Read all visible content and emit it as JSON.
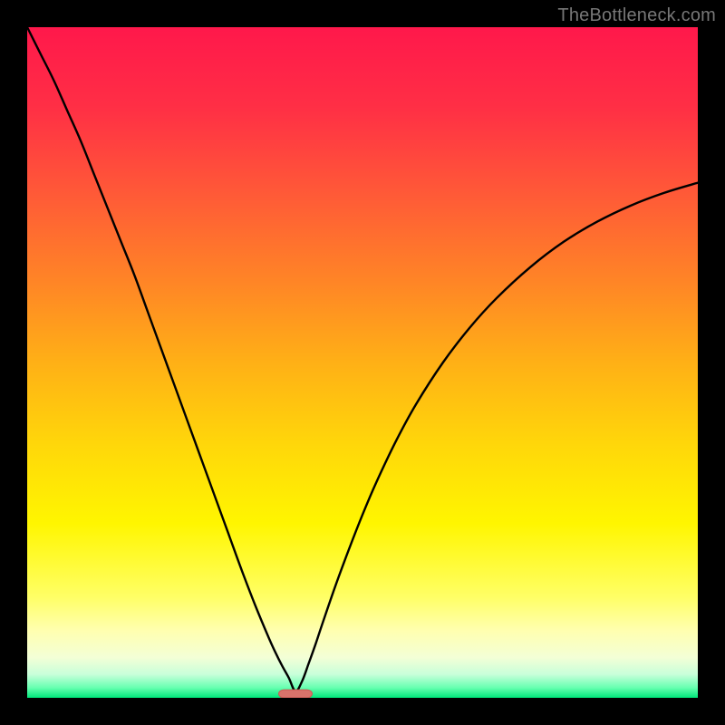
{
  "watermark": "TheBottleneck.com",
  "colors": {
    "background": "#000000",
    "curve": "#000000",
    "marker_fill": "#d9736b",
    "marker_stroke": "#cf5a55",
    "gradient_stops": [
      {
        "offset": 0.0,
        "color": "#ff184b"
      },
      {
        "offset": 0.12,
        "color": "#ff2f45"
      },
      {
        "offset": 0.25,
        "color": "#ff5a37"
      },
      {
        "offset": 0.38,
        "color": "#ff8526"
      },
      {
        "offset": 0.5,
        "color": "#ffb016"
      },
      {
        "offset": 0.62,
        "color": "#ffd60a"
      },
      {
        "offset": 0.74,
        "color": "#fff600"
      },
      {
        "offset": 0.85,
        "color": "#ffff66"
      },
      {
        "offset": 0.9,
        "color": "#ffffb0"
      },
      {
        "offset": 0.94,
        "color": "#f3ffd6"
      },
      {
        "offset": 0.965,
        "color": "#c8ffda"
      },
      {
        "offset": 0.985,
        "color": "#66ffb0"
      },
      {
        "offset": 1.0,
        "color": "#00e67a"
      }
    ]
  },
  "chart_data": {
    "type": "line",
    "title": "",
    "xlabel": "",
    "ylabel": "",
    "xlim": [
      0,
      100
    ],
    "ylim": [
      0,
      100
    ],
    "marker": {
      "x": 40,
      "y": 0,
      "width": 5,
      "height": 1.2
    },
    "series": [
      {
        "name": "bottleneck-curve",
        "x": [
          0,
          2,
          4,
          6,
          8,
          10,
          12,
          14,
          16,
          18,
          20,
          22,
          24,
          26,
          28,
          30,
          32,
          34,
          36,
          37,
          38,
          39,
          40,
          41,
          42,
          43,
          44,
          46,
          48,
          50,
          52,
          55,
          58,
          62,
          66,
          70,
          75,
          80,
          85,
          90,
          95,
          100
        ],
        "y": [
          100,
          96,
          92,
          87.5,
          83,
          78,
          73,
          68,
          63,
          57.5,
          52,
          46.5,
          41,
          35.5,
          30,
          24.5,
          19,
          13.8,
          9,
          6.8,
          4.8,
          3,
          1,
          2.5,
          5.2,
          8,
          11,
          16.8,
          22.2,
          27.3,
          32,
          38.3,
          43.8,
          50,
          55.2,
          59.6,
          64.2,
          68,
          71,
          73.4,
          75.3,
          76.8
        ]
      }
    ]
  }
}
